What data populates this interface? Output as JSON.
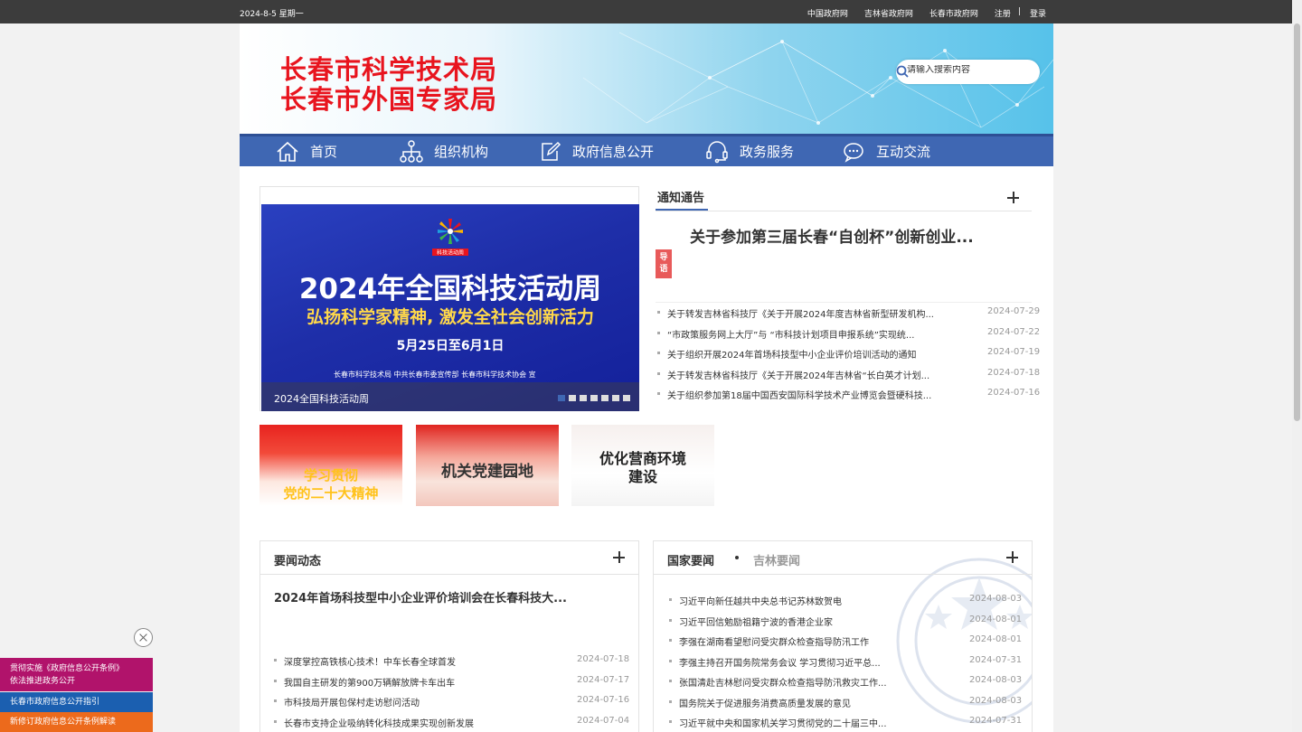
{
  "topbar": {
    "date": "2024-8-5 星期一",
    "links": [
      "中国政府网",
      "吉林省政府网",
      "长春市政府网",
      "注册",
      "登录"
    ]
  },
  "header": {
    "title_line1": "长春市科学技术局",
    "title_line2": "长春市外国专家局",
    "search_placeholder": "请输入搜索内容"
  },
  "nav": [
    {
      "label": "首页",
      "icon": "home-icon"
    },
    {
      "label": "组织机构",
      "icon": "org-chart-icon"
    },
    {
      "label": "政府信息公开",
      "icon": "edit-icon"
    },
    {
      "label": "政务服务",
      "icon": "headset-icon"
    },
    {
      "label": "互动交流",
      "icon": "chat-icon"
    }
  ],
  "slider": {
    "heading": "2024年全国科技活动周",
    "slogan": "弘扬科学家精神, 激发全社会创新活力",
    "dates": "5月25日至6月1日",
    "orgs": "长春市科学技术局  中共长春市委宣传部  长春市科学技术协会  宣",
    "caption": "2024全国科技活动周",
    "logo_text": "科技活动周",
    "dots": 7,
    "active_dot": 0
  },
  "notice": {
    "heading": "通知通告",
    "featured": "关于参加第三届长春“自创杯”创新创业...",
    "badge": "导语",
    "items": [
      {
        "title": "关于转发吉林省科技厅《关于开展2024年度吉林省新型研发机构...",
        "date": "2024-07-29"
      },
      {
        "title": "“市政策服务网上大厅”与 “市科技计划项目申报系统”实现统...",
        "date": "2024-07-22"
      },
      {
        "title": "关于组织开展2024年首场科技型中小企业评价培训活动的通知",
        "date": "2024-07-19"
      },
      {
        "title": "关于转发吉林省科技厅《关于开展2024年吉林省“长白英才计划...",
        "date": "2024-07-18"
      },
      {
        "title": "关于组织参加第18届中国西安国际科学技术产业博览会暨硬科技...",
        "date": "2024-07-16"
      }
    ]
  },
  "promos": [
    "学习贯彻\n党的二十大精神",
    "机关党建园地",
    "优化营商环境\n建设"
  ],
  "news": {
    "heading": "要闻动态",
    "featured": "2024年首场科技型中小企业评价培训会在长春科技大...",
    "items": [
      {
        "title": "深度掌控高铁核心技术！中车长春全球首发",
        "date": "2024-07-18"
      },
      {
        "title": "我国自主研发的第900万辆解放牌卡车出车",
        "date": "2024-07-17"
      },
      {
        "title": "市科技局开展包保村走访慰问活动",
        "date": "2024-07-16"
      },
      {
        "title": "长春市支持企业吸纳转化科技成果实现创新发展",
        "date": "2024-07-04"
      }
    ]
  },
  "national": {
    "heading": "国家要闻",
    "heading2": "吉林要闻",
    "items": [
      {
        "title": "习近平向新任越共中央总书记苏林致贺电",
        "date": "2024-08-03"
      },
      {
        "title": "习近平回信勉励祖籍宁波的香港企业家",
        "date": "2024-08-01"
      },
      {
        "title": "李强在湖南看望慰问受灾群众检查指导防汛工作",
        "date": "2024-08-01"
      },
      {
        "title": "李强主持召开国务院常务会议 学习贯彻习近平总...",
        "date": "2024-07-31"
      },
      {
        "title": "张国清赴吉林慰问受灾群众检查指导防汛救灾工作...",
        "date": "2024-08-03"
      },
      {
        "title": "国务院关于促进服务消费高质量发展的意见",
        "date": "2024-08-03"
      },
      {
        "title": "习近平就中央和国家机关学习贯彻党的二十届三中...",
        "date": "2024-07-31"
      }
    ]
  },
  "float_ads": [
    "贯彻实施《政府信息公开条例》\n依法推进政务公开",
    "长春市政府信息公开指引",
    "新修订政府信息公开条例解读"
  ]
}
